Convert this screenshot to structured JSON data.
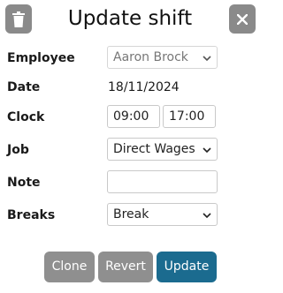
{
  "header": {
    "title": "Update shift",
    "delete_icon": "trash-icon",
    "close_icon": "close-icon"
  },
  "form": {
    "employee": {
      "label": "Employee",
      "value": "Aaron Brock"
    },
    "date": {
      "label": "Date",
      "value": "18/11/2024"
    },
    "clock": {
      "label": "Clock",
      "start": "09:00",
      "end": "17:00"
    },
    "job": {
      "label": "Job",
      "value": "Direct Wages"
    },
    "note": {
      "label": "Note",
      "value": "",
      "placeholder": ""
    },
    "breaks": {
      "label": "Breaks",
      "value": "Break"
    }
  },
  "footer": {
    "clone_label": "Clone",
    "revert_label": "Revert",
    "update_label": "Update"
  },
  "colors": {
    "grey_button": "#8f8f8f",
    "primary_button": "#1b6b8f"
  }
}
